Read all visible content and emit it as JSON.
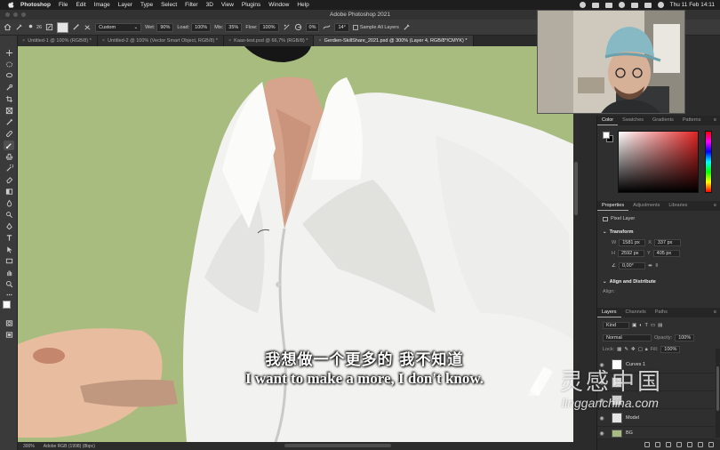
{
  "menubar": {
    "app": "Photoshop",
    "items": [
      "File",
      "Edit",
      "Image",
      "Layer",
      "Type",
      "Select",
      "Filter",
      "3D",
      "View",
      "Plugins",
      "Window",
      "Help"
    ],
    "clock": "Thu 11 Feb  14:11"
  },
  "window": {
    "title": "Adobe Photoshop 2021"
  },
  "options": {
    "brush_size": "26",
    "preset": "Custom",
    "wet_label": "Wet:",
    "wet_value": "90%",
    "load_label": "Load:",
    "load_value": "100%",
    "mix_label": "Mix:",
    "mix_value": "35%",
    "flow_label": "Flow:",
    "flow_value": "100%",
    "angle_value": "0%",
    "smoothing_value": "14°",
    "sample_all_label": "Sample All Layers"
  },
  "tabs": [
    "Untitled-1 @ 100% (RGB/8) *",
    "Untitled-2 @ 100% (Vector Smart Object, RGB/8) *",
    "Kaas-test.psd @ 66,7% (RGB/8) *",
    "Gerdien-SkillShare_2021.psd @ 300% (Layer 4, RGB/8*/CMYK) *"
  ],
  "active_tab_index": 3,
  "status": {
    "zoom": "300%",
    "profile": "Adobe RGB (1998) (8bpc)"
  },
  "subtitles": {
    "zh": "我想做一个更多的 我不知道",
    "en": "I want to make a more, I don't know."
  },
  "color_panel": {
    "tabs": [
      "Color",
      "Swatches",
      "Gradients",
      "Patterns"
    ],
    "hue_color": "#e02424"
  },
  "properties_panel": {
    "tabs": [
      "Properties",
      "Adjustments",
      "Libraries"
    ],
    "kind": "Pixel Layer",
    "transform_label": "Transform",
    "w_label": "W",
    "w_value": "1581 px",
    "h_label": "H",
    "h_value": "2592 px",
    "x_label": "X",
    "x_value": "337 px",
    "y_label": "Y",
    "y_value": "405 px",
    "angle_value": "0,00°",
    "align_title": "Align and Distribute",
    "align_label": "Align:"
  },
  "layers_panel": {
    "tabs": [
      "Layers",
      "Channels",
      "Paths"
    ],
    "kind_filter": "Kind",
    "blend_mode": "Normal",
    "opacity_label": "Opacity:",
    "opacity_value": "100%",
    "lock_label": "Lock:",
    "fill_label": "Fill:",
    "fill_value": "100%",
    "layers": [
      {
        "name": "Curves 1",
        "thumb": "#ffffff"
      },
      {
        "name": "",
        "thumb": "#d9d9d9"
      },
      {
        "name": "",
        "thumb": "#cfcfcf"
      },
      {
        "name": "Model",
        "thumb": "#e6e6e6"
      },
      {
        "name": "BG",
        "thumb": "#a9bc7f"
      }
    ]
  },
  "watermark": {
    "cn": "灵感中国",
    "url": "lingganchina.com"
  }
}
